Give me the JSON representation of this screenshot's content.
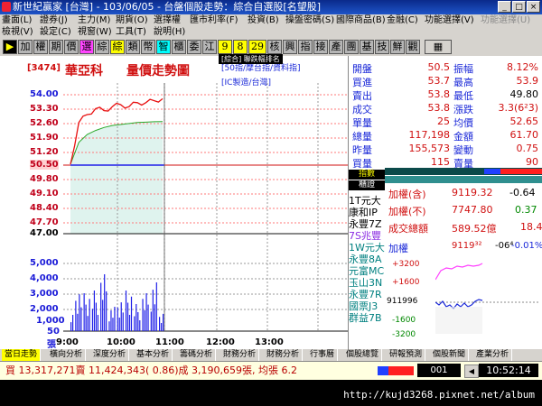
{
  "window": {
    "title": "新世紀贏家 [台灣] - 103/06/05 - 台盤個股走勢：綜合自選股[名望股]"
  },
  "menu1": [
    "畫面(L)",
    "證券(J)",
    "主力(M)",
    "期貨(O)",
    "選擇權",
    "匯市利率(F)",
    "投資(B)",
    "操盤密碼(S)",
    "國際商品(B)",
    "金融(C)",
    "功能選擇(V)",
    "功能選擇(U)"
  ],
  "menu2": [
    "檢視(V)",
    "設定(C)",
    "視窗(W)",
    "工具(T)",
    "說明(H)"
  ],
  "toolbar": [
    "加",
    "權",
    "期",
    "價",
    "選",
    "綜",
    "綜",
    "類",
    "幣",
    "智",
    "櫃",
    "委",
    "江",
    "9",
    "8",
    "29",
    "核",
    "興",
    "指",
    "接",
    "產",
    "團",
    "基",
    "技",
    "鮮",
    "觀"
  ],
  "header": {
    "code": "[3474]",
    "name": "華亞科",
    "view": "量價走勢圖",
    "tag1": "[50指/摩台指/資料指]",
    "tag2": "[IC製造/台灣]",
    "tag3": "[綜合] 聯跌幅排名"
  },
  "yaxis_price": [
    "54.00",
    "53.30",
    "52.60",
    "51.90",
    "51.20",
    "50.50",
    "49.80",
    "49.10",
    "48.40",
    "47.70",
    "47.00"
  ],
  "yaxis_vol": [
    "5,000",
    "4,000",
    "3,000",
    "2,000",
    "1,000",
    "50",
    "張"
  ],
  "xaxis": [
    "9:00",
    "10:00",
    "11:00",
    "12:00",
    "13:00"
  ],
  "quote_left": [
    {
      "label": "開盤",
      "value": "50.5"
    },
    {
      "label": "買進",
      "value": "53.7"
    },
    {
      "label": "賣出",
      "value": "53.8"
    },
    {
      "label": "成交",
      "value": "53.8"
    },
    {
      "label": "單量",
      "value": "25"
    },
    {
      "label": "總量",
      "value": "117,198"
    },
    {
      "label": "昨量",
      "value": "155,573"
    },
    {
      "label": "買量",
      "value": "115"
    }
  ],
  "quote_right": [
    {
      "label": "振幅",
      "value": "8.12%"
    },
    {
      "label": "最高",
      "value": "53.9"
    },
    {
      "label": "最低",
      "value": "49.80"
    },
    {
      "label": "漲跌",
      "value": "3.3(6²3)"
    },
    {
      "label": "均價",
      "value": "52.65"
    },
    {
      "label": "金額",
      "value": "61.70"
    },
    {
      "label": "變動",
      "value": "0.75"
    },
    {
      "label": "賣量",
      "value": "90"
    }
  ],
  "brokers": {
    "head1": "指數",
    "head2": "櫃證",
    "list": [
      "1T元大",
      "康和IP",
      "永豐7Z",
      "7S兆豐",
      "1W元大",
      "永豐8A",
      "元富MC",
      "玉山3N",
      "永豐7R",
      "國票J3",
      "群益7B"
    ]
  },
  "index_box": {
    "rows": [
      {
        "label": "加權(含)",
        "value": "9119.32",
        "change": "-0.64"
      },
      {
        "label": "加權(不)",
        "value": "7747.80",
        "change": "0.37"
      },
      {
        "label": "成交總額",
        "value": "589.52億",
        "change": "18.4"
      }
    ]
  },
  "mini": {
    "title": "加權",
    "value": "9119³²",
    "delta": "-06⁴",
    "pct": "-0.01%",
    "labels": [
      "+3200",
      "+1600",
      "911996",
      "-1600",
      "-3200"
    ]
  },
  "tabs": [
    "當日走勢",
    "橫向分析",
    "深度分析",
    "基本分析",
    "籌碼分析",
    "財務分析",
    "財務分析",
    "行事曆",
    "個股總覽",
    "研報預測",
    "個股新聞",
    "產業分析"
  ],
  "status": {
    "text": "買 13,317,271賣 11,424,343( 0.86)成 3,190,659張, 均張 6.2",
    "code": "001",
    "time": "10:52:14"
  },
  "watermark": "http://kujd3268.pixnet.net/album",
  "colors": {
    "price": "#e81010",
    "avg": "#2aa82a",
    "vol": "#2020e8",
    "bg": "#ffffff",
    "panel": "#d6d3ce"
  },
  "chart_data": {
    "type": "line",
    "title": "量價走勢圖",
    "x": [
      "9:00",
      "9:10",
      "9:20",
      "9:30",
      "9:40",
      "9:50",
      "10:00",
      "10:10",
      "10:20",
      "10:30",
      "10:40",
      "10:50"
    ],
    "series": [
      {
        "name": "price",
        "values": [
          50.5,
          52.6,
          53.0,
          53.3,
          53.2,
          53.4,
          53.5,
          53.4,
          53.6,
          53.6,
          53.7,
          53.8
        ]
      },
      {
        "name": "avg",
        "values": [
          50.5,
          51.6,
          52.0,
          52.2,
          52.35,
          52.45,
          52.5,
          52.55,
          52.6,
          52.62,
          52.64,
          52.65
        ]
      },
      {
        "name": "volume",
        "values": [
          1200,
          3200,
          2800,
          3000,
          4200,
          1800,
          2500,
          3000,
          2000,
          2800,
          3600,
          1500
        ]
      }
    ],
    "ylim_price": [
      47.0,
      54.0
    ],
    "ylim_volume": [
      0,
      5000
    ]
  }
}
